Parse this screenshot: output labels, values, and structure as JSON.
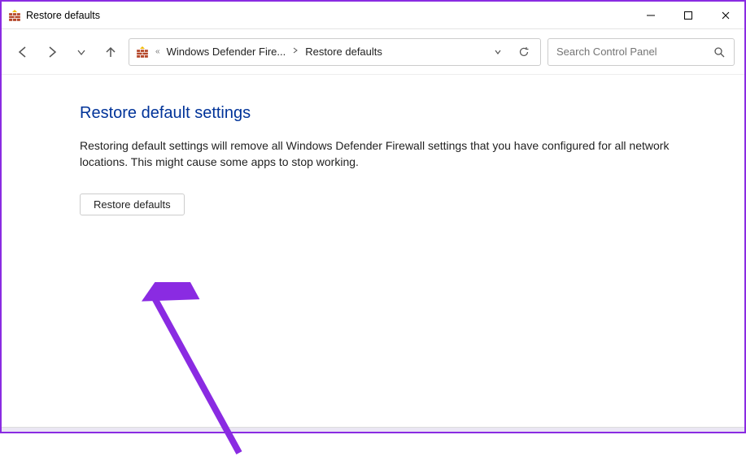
{
  "window": {
    "title": "Restore defaults"
  },
  "nav": {
    "breadcrumb_parent": "Windows Defender Fire...",
    "breadcrumb_current": "Restore defaults"
  },
  "search": {
    "placeholder": "Search Control Panel"
  },
  "content": {
    "heading": "Restore default settings",
    "body": "Restoring default settings will remove all Windows Defender Firewall settings that you have configured for all network locations. This might cause some apps to stop working.",
    "restore_button_label": "Restore defaults"
  }
}
